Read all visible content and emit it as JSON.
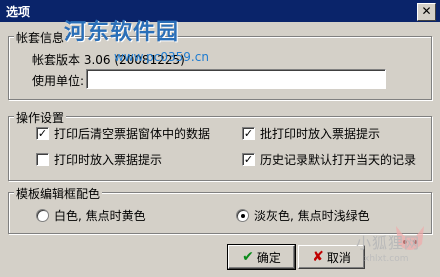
{
  "window": {
    "title": "选项",
    "close_glyph": "✕"
  },
  "watermark": {
    "logo_text": "河东软件园",
    "logo_url": "www.pc0359.cn",
    "corner_text": "小狐狸网",
    "corner_url": "xhlxt.com"
  },
  "account": {
    "group_title": "帐套信息",
    "version_text": "帐套版本 3.06 (20081225)",
    "unit_label": "使用单位:",
    "unit_value": ""
  },
  "operation": {
    "group_title": "操作设置",
    "checkboxes": [
      {
        "label": "打印后清空票据窗体中的数据",
        "checked": true
      },
      {
        "label": "批打印时放入票据提示",
        "checked": true
      },
      {
        "label": "打印时放入票据提示",
        "checked": false
      },
      {
        "label": "历史记录默认打开当天的记录",
        "checked": true
      }
    ]
  },
  "template": {
    "group_title": "模板编辑框配色",
    "radios": [
      {
        "label": "白色, 焦点时黄色",
        "selected": false
      },
      {
        "label": "淡灰色, 焦点时浅绿色",
        "selected": true
      }
    ]
  },
  "buttons": {
    "ok_label": "确定",
    "cancel_label": "取消",
    "ok_icon": "check-icon",
    "cancel_icon": "x-icon"
  }
}
